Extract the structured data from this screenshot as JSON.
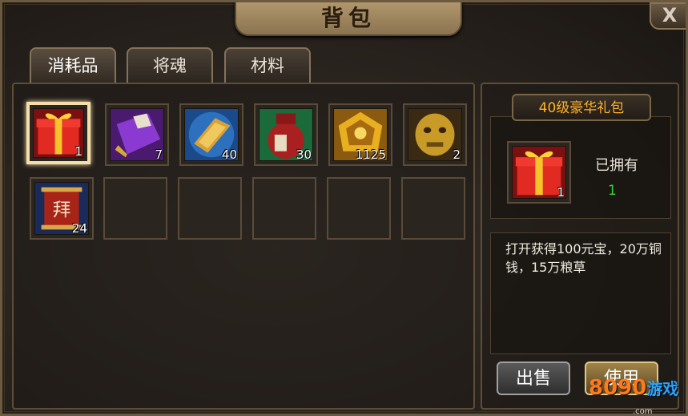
{
  "window": {
    "title": "背包",
    "close_label": "X"
  },
  "tabs": [
    {
      "label": "消耗品",
      "active": true
    },
    {
      "label": "将魂",
      "active": false
    },
    {
      "label": "材料",
      "active": false
    }
  ],
  "inventory": [
    {
      "icon": "gift-box-icon",
      "count": "1",
      "selected": true
    },
    {
      "icon": "purple-book-icon",
      "count": "7"
    },
    {
      "icon": "gold-token-icon",
      "count": "40"
    },
    {
      "icon": "wine-jar-icon",
      "count": "30"
    },
    {
      "icon": "gold-badge-icon",
      "count": "1125"
    },
    {
      "icon": "bronze-mask-icon",
      "count": "2"
    },
    {
      "icon": "scroll-banner-icon",
      "count": "24"
    }
  ],
  "detail": {
    "name": "40级豪华礼包",
    "owned_label": "已拥有",
    "owned_value": "1",
    "icon_count": "1",
    "description": "打开获得100元宝，20万铜钱，15万粮草"
  },
  "buttons": {
    "sell": "出售",
    "use": "使用"
  },
  "watermark": {
    "text": "8090",
    "sub_text": "游戏",
    "domain": ".com"
  },
  "colors": {
    "item_name": "#ffb32a",
    "owned_value": "#3ad03a",
    "watermark": "#ff7a1a"
  }
}
